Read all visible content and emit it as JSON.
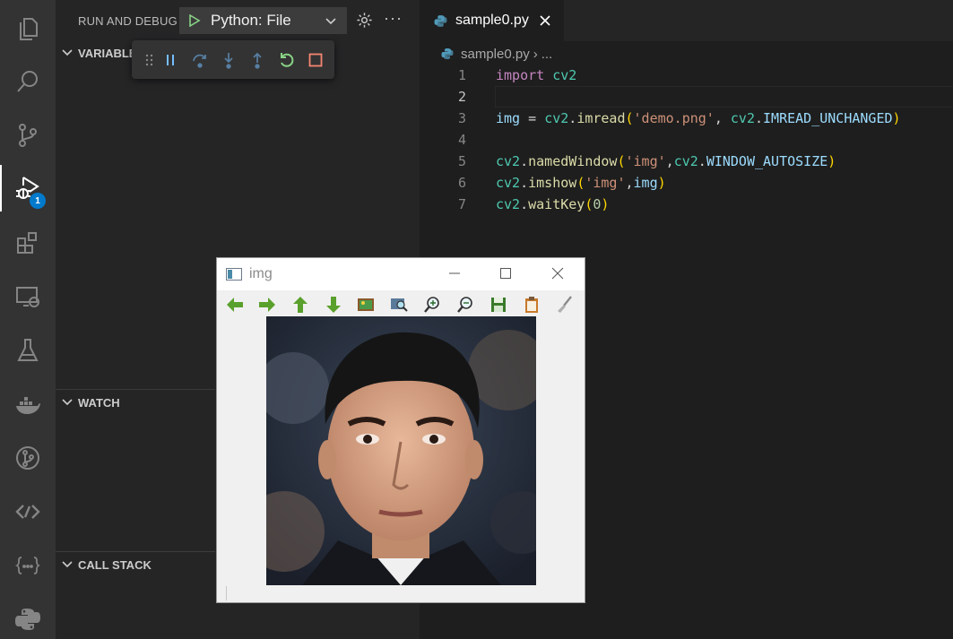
{
  "activity_bar": {
    "items": [
      {
        "name": "explorer-icon"
      },
      {
        "name": "search-icon"
      },
      {
        "name": "source-control-icon"
      },
      {
        "name": "run-debug-icon",
        "active": true,
        "badge": "1"
      },
      {
        "name": "extensions-icon"
      },
      {
        "name": "remote-explorer-icon"
      },
      {
        "name": "testing-icon"
      },
      {
        "name": "docker-icon"
      },
      {
        "name": "git-graph-icon"
      },
      {
        "name": "live-share-icon"
      },
      {
        "name": "json-icon"
      },
      {
        "name": "python-icon"
      }
    ]
  },
  "sidebar": {
    "title": "RUN AND DEBUG",
    "config": "Python: File",
    "sections": {
      "variables": "VARIABLES",
      "watch": "WATCH",
      "call_stack": "CALL STACK"
    }
  },
  "debug_toolbar": {
    "buttons": [
      "drag-handle",
      "pause",
      "step-over",
      "step-into",
      "step-out",
      "restart",
      "stop"
    ]
  },
  "editor": {
    "tab": "sample0.py",
    "breadcrumb": [
      "sample0.py",
      "..."
    ],
    "current_line": 2,
    "line_numbers": [
      "1",
      "2",
      "3",
      "4",
      "5",
      "6",
      "7"
    ]
  },
  "image_window": {
    "title": "img",
    "toolbar": [
      "back",
      "forward",
      "up",
      "down",
      "image",
      "zoom-fit",
      "zoom-in",
      "zoom-out",
      "save",
      "properties",
      "settings"
    ]
  },
  "colors": {
    "accent": "#007acc",
    "editor_bg": "#1e1e1e",
    "sidebar_bg": "#252526",
    "activity_bg": "#333333"
  }
}
